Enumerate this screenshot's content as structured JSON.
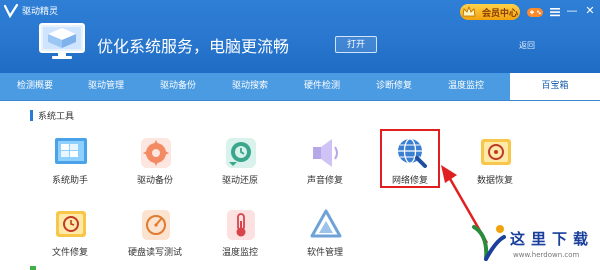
{
  "titlebar": {
    "app_title": "驱动精灵",
    "vip_label": "会员中心",
    "minimize": "—",
    "close": "✕"
  },
  "banner": {
    "title": "优化系统服务，电脑更流畅",
    "open_button": "打开",
    "back_link": "返回"
  },
  "nav_tabs": [
    {
      "label": "检测概要"
    },
    {
      "label": "驱动管理"
    },
    {
      "label": "驱动备份"
    },
    {
      "label": "驱动搜索"
    },
    {
      "label": "硬件检测"
    },
    {
      "label": "诊断修复"
    },
    {
      "label": "温度监控"
    },
    {
      "label": "百宝箱",
      "active": true
    }
  ],
  "section": {
    "title": "系统工具"
  },
  "tools": [
    {
      "label": "系统助手",
      "icon": "system-assistant-icon"
    },
    {
      "label": "驱动备份",
      "icon": "driver-backup-icon"
    },
    {
      "label": "驱动还原",
      "icon": "driver-restore-icon"
    },
    {
      "label": "声音修复",
      "icon": "sound-repair-icon"
    },
    {
      "label": "网络修复",
      "icon": "network-repair-icon",
      "highlighted": true
    },
    {
      "label": "数据恢复",
      "icon": "data-recovery-icon"
    },
    {
      "label": "文件修复",
      "icon": "file-repair-icon"
    },
    {
      "label": "硬盘读写测试",
      "icon": "disk-rw-test-icon"
    },
    {
      "label": "温度监控",
      "icon": "temperature-monitor-icon"
    },
    {
      "label": "软件管理",
      "icon": "software-manager-icon"
    }
  ],
  "watermark": {
    "text": "这里下载",
    "url": "www.herdown.com"
  },
  "colors": {
    "header_blue": "#2a78d0",
    "nav_blue": "#4a9be2",
    "highlight_red": "#e02020",
    "accent_orange": "#f2a20d"
  }
}
